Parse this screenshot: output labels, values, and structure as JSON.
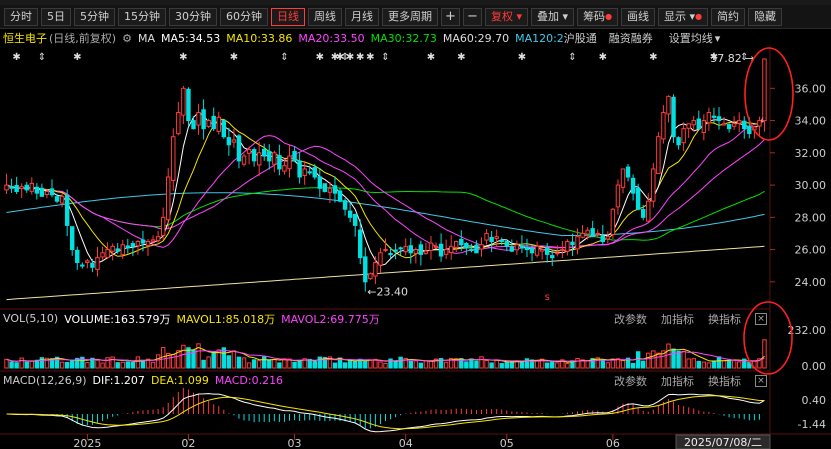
{
  "toolbar": {
    "periods": [
      "分时",
      "5日",
      "5分钟",
      "15分钟",
      "30分钟",
      "60分钟",
      "日线",
      "周线",
      "月线",
      "更多周期"
    ],
    "active_period": "日线",
    "plus": "+",
    "minus": "−",
    "fuquan": "复权",
    "diejia": "叠加",
    "chouma": "筹码",
    "huaxian": "画线",
    "xianshi": "显示",
    "jianyue": "简约",
    "yincang": "隐藏"
  },
  "ma_bar": {
    "stock_name": "恒生电子",
    "mode": "(日线,前复权)",
    "ma_label": "MA",
    "ma5": "MA5:34.53",
    "ma10": "MA10:33.86",
    "ma20": "MA20:33.50",
    "ma30": "MA30:32.73",
    "ma60": "MA60:29.70",
    "ma120": "MA120:2",
    "hgt": "沪股通",
    "rzrq": "融资融券",
    "set_ma": "设置均线"
  },
  "vol_header": {
    "label": "VOL(5,10)",
    "volume": "VOLUME:163.579万",
    "mavol1": "MAVOL1:85.018万",
    "mavol2": "MAVOL2:69.775万",
    "gaicanshu": "改参数",
    "jiazhibiao": "加指标",
    "huanzhibiao": "换指标",
    "close": "×"
  },
  "macd_header": {
    "label": "MACD(12,26,9)",
    "dif": "DIF:1.207",
    "dea": "DEA:1.099",
    "macd": "MACD:0.216",
    "gaicanshu": "改参数",
    "jiazhibiao": "加指标",
    "huanzhibiao": "换指标",
    "close": "×"
  },
  "colors": {
    "up": "#ff3b3b",
    "down": "#00e0e0",
    "ma5": "#ffffff",
    "ma10": "#f5e400",
    "ma20": "#ff44ff",
    "ma30": "#00e000",
    "ma60": "#40c8e8",
    "ma120": "#c8c8c8",
    "ma250": "#f0e0a0",
    "annotation": "#ff2020"
  },
  "chart_data": [
    {
      "type": "candlestick",
      "price_ylim": [
        22.5,
        38.5
      ],
      "y_ticks": [
        24.0,
        26.0,
        28.0,
        30.0,
        32.0,
        34.0,
        36.0
      ],
      "y_tick_labels": [
        "24.00",
        "26.00",
        "28.00",
        "30.00",
        "32.00",
        "34.00",
        "36.00"
      ],
      "x_month_labels": [
        "2025",
        "02",
        "03",
        "04",
        "05",
        "06",
        "07"
      ],
      "x_month_positions": [
        16,
        36,
        57,
        79,
        99,
        120,
        141
      ],
      "date_box": "2025/07/08/二",
      "high_annotation": {
        "label": "37.82",
        "value": 37.82,
        "index": 150
      },
      "low_annotation": {
        "label": "23.40",
        "value": 23.4,
        "index": 71
      },
      "closes": [
        30.0,
        29.8,
        29.6,
        29.9,
        29.7,
        30.1,
        29.5,
        29.3,
        29.6,
        29.4,
        29.0,
        29.3,
        27.5,
        26.0,
        25.2,
        25.0,
        25.3,
        24.9,
        25.5,
        25.8,
        26.0,
        26.2,
        25.9,
        26.3,
        26.1,
        26.2,
        26.5,
        26.4,
        26.5,
        26.6,
        26.8,
        28.0,
        30.5,
        33.0,
        34.5,
        36.0,
        34.0,
        33.5,
        34.5,
        33.5,
        34.0,
        33.5,
        34.2,
        33.0,
        32.5,
        32.8,
        31.5,
        31.8,
        32.2,
        31.5,
        32.0,
        31.8,
        31.5,
        32.0,
        31.0,
        31.2,
        31.8,
        31.5,
        30.5,
        31.0,
        30.8,
        30.5,
        29.8,
        29.6,
        29.8,
        29.5,
        29.0,
        28.5,
        28.0,
        27.5,
        25.5,
        24.0,
        24.5,
        25.2,
        25.8,
        26.0,
        25.7,
        25.9,
        26.1,
        26.2,
        25.8,
        26.0,
        25.7,
        25.9,
        26.4,
        26.2,
        25.6,
        26.0,
        26.2,
        26.5,
        26.3,
        26.1,
        26.0,
        25.8,
        26.3,
        27.0,
        26.5,
        26.8,
        26.5,
        26.2,
        25.9,
        26.3,
        26.1,
        26.0,
        25.8,
        26.2,
        26.0,
        25.7,
        25.5,
        25.8,
        26.0,
        26.5,
        26.3,
        26.8,
        27.0,
        27.2,
        26.8,
        27.0,
        26.5,
        26.8,
        28.5,
        30.0,
        31.0,
        30.5,
        29.5,
        28.5,
        28.0,
        29.0,
        31.0,
        33.0,
        34.5,
        35.5,
        33.0,
        32.5,
        33.5,
        33.8,
        34.0,
        33.5,
        34.0,
        34.5,
        34.2,
        34.0,
        33.8,
        33.5,
        33.8,
        34.0,
        33.5,
        33.2,
        33.6,
        34.0,
        37.82
      ],
      "overlay_lines": [
        "MA5",
        "MA10",
        "MA20",
        "MA30",
        "MA60",
        "MA120",
        "MA250"
      ]
    },
    {
      "type": "bar",
      "name": "VOL",
      "y_tick_labels": [
        "232.00",
        "0.00"
      ],
      "ylim": [
        0,
        232
      ],
      "last_volume_wan": 163.579,
      "mavol1_wan": 85.018,
      "mavol2_wan": 69.775
    },
    {
      "type": "bar",
      "name": "MACD",
      "y_tick_labels": [
        "0.40",
        "-1.44"
      ],
      "dif": 1.207,
      "dea": 1.099,
      "macd": 0.216
    }
  ]
}
